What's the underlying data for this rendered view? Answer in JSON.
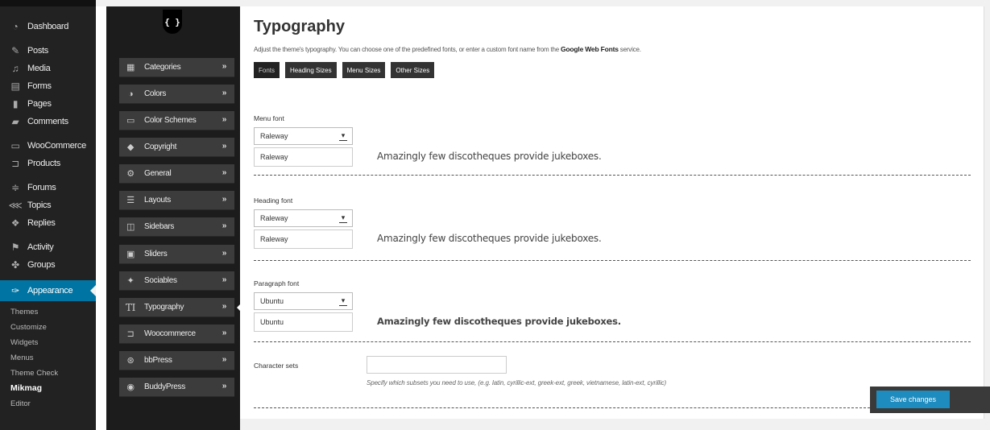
{
  "wp_menu": {
    "items": [
      {
        "label": "Dashboard",
        "icon": "dashboard-icon"
      },
      {
        "label": "Posts",
        "icon": "pin-icon"
      },
      {
        "label": "Media",
        "icon": "media-icon"
      },
      {
        "label": "Forms",
        "icon": "forms-icon"
      },
      {
        "label": "Pages",
        "icon": "pages-icon"
      },
      {
        "label": "Comments",
        "icon": "comment-icon"
      },
      {
        "label": "WooCommerce",
        "icon": "woocommerce-icon"
      },
      {
        "label": "Products",
        "icon": "cart-icon"
      },
      {
        "label": "Forums",
        "icon": "forums-icon"
      },
      {
        "label": "Topics",
        "icon": "topics-icon"
      },
      {
        "label": "Replies",
        "icon": "replies-icon"
      },
      {
        "label": "Activity",
        "icon": "activity-icon"
      },
      {
        "label": "Groups",
        "icon": "groups-icon"
      },
      {
        "label": "Appearance",
        "icon": "brush-icon"
      }
    ],
    "submenu": [
      "Themes",
      "Customize",
      "Widgets",
      "Menus",
      "Theme Check",
      "Mikmag",
      "Editor"
    ],
    "current_sub": "Mikmag"
  },
  "options_panel": {
    "logo": "{ }",
    "items": [
      {
        "label": "Categories",
        "icon": "grid-icon"
      },
      {
        "label": "Colors",
        "icon": "contrast-icon"
      },
      {
        "label": "Color Schemes",
        "icon": "laptop-icon"
      },
      {
        "label": "Copyright",
        "icon": "tag-icon"
      },
      {
        "label": "General",
        "icon": "cogs-icon"
      },
      {
        "label": "Layouts",
        "icon": "list-icon"
      },
      {
        "label": "Sidebars",
        "icon": "columns-icon"
      },
      {
        "label": "Sliders",
        "icon": "image-icon"
      },
      {
        "label": "Sociables",
        "icon": "twitter-icon"
      },
      {
        "label": "Typography",
        "icon": "text-size-icon"
      },
      {
        "label": "Woocommerce",
        "icon": "cart-icon"
      },
      {
        "label": "bbPress",
        "icon": "bbpress-icon"
      },
      {
        "label": "BuddyPress",
        "icon": "buddypress-icon"
      }
    ],
    "arrow": "»",
    "active": "Typography"
  },
  "main": {
    "title": "Typography",
    "description_before": "Adjust the theme's typography. You can choose one of the predefined fonts, or enter a custom font name from the ",
    "description_link": "Google Web Fonts",
    "description_after": " service.",
    "tabs": [
      "Fonts",
      "Heading Sizes",
      "Menu Sizes",
      "Other Sizes"
    ],
    "active_tab": "Fonts",
    "fonts": [
      {
        "label": "Menu font",
        "selected": "Raleway",
        "custom": "Raleway",
        "preview": "Amazingly few discotheques provide jukeboxes."
      },
      {
        "label": "Heading font",
        "selected": "Raleway",
        "custom": "Raleway",
        "preview": "Amazingly few discotheques provide jukeboxes."
      },
      {
        "label": "Paragraph font",
        "selected": "Ubuntu",
        "custom": "Ubuntu",
        "preview": "Amazingly few discotheques provide jukeboxes."
      }
    ],
    "charset": {
      "label": "Character sets",
      "value": "",
      "hint": "Specify which subsets you need to use, (e.g. latin, cyrillic-ext, greek-ext, greek, vietnamese, latin-ext, cyrillic)"
    },
    "save_label": "Save changes"
  }
}
